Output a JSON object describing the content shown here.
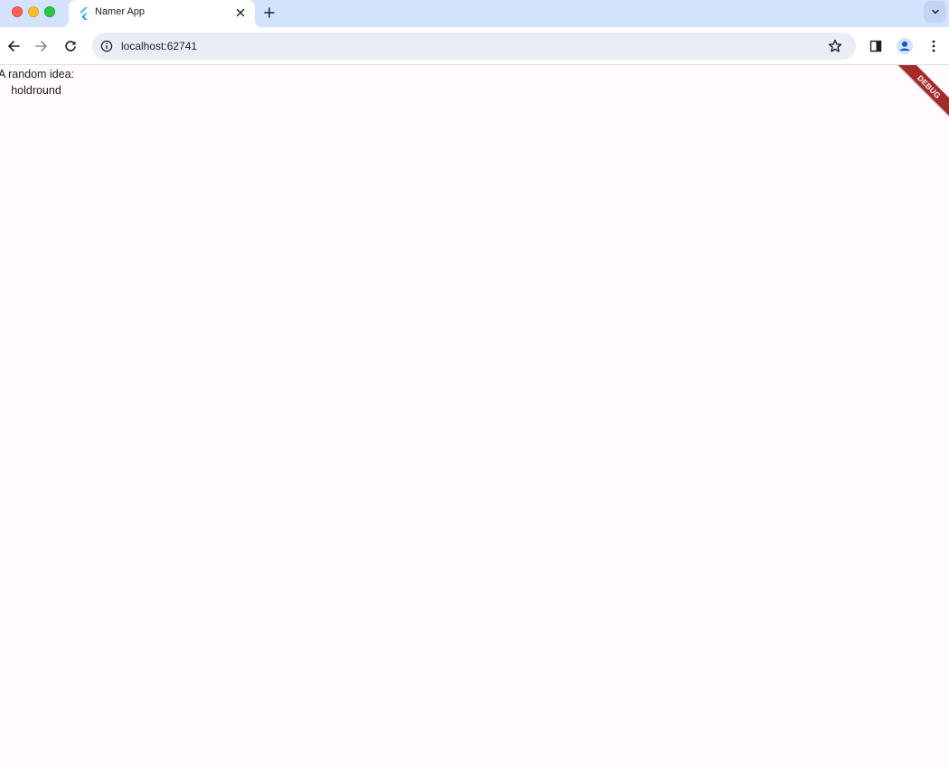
{
  "browser": {
    "tab": {
      "title": "Namer App",
      "favicon": "flutter-logo-icon"
    },
    "toolbar": {
      "url": "localhost:62741"
    },
    "icons": [
      "back-arrow-icon",
      "forward-arrow-icon",
      "reload-icon",
      "site-info-icon",
      "bookmark-star-icon",
      "side-panel-icon",
      "profile-avatar-icon",
      "kebab-menu-icon",
      "close-icon",
      "plus-icon",
      "chevron-down-icon"
    ],
    "colors": {
      "tabstrip": "#d3e3fd",
      "omnibox": "#e9eef6",
      "accent": "#0b57d0"
    }
  },
  "app": {
    "label": "A random idea:",
    "word": "holdround",
    "debug_banner": "DEBUG",
    "colors": {
      "background": "#fffbfe",
      "banner": "#a52a2a"
    }
  }
}
